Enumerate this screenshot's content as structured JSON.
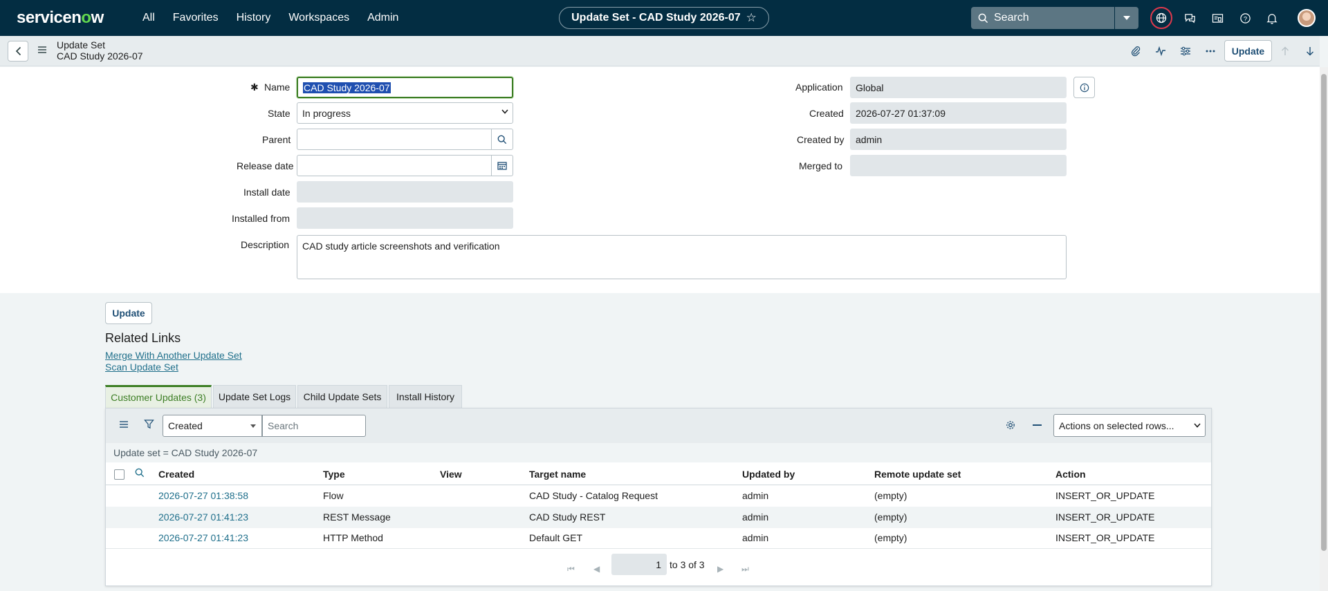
{
  "topnav": {
    "logo": "servicenow",
    "menu": [
      "All",
      "Favorites",
      "History",
      "Workspaces",
      "Admin"
    ],
    "title": "Update Set - CAD Study 2026-07",
    "search_placeholder": "Search",
    "icons": [
      "globe-icon",
      "chat-icon",
      "inbox-icon",
      "help-icon",
      "bell-icon"
    ]
  },
  "header": {
    "line1": "Update Set",
    "line2": "CAD Study 2026-07",
    "update_label": "Update"
  },
  "form": {
    "name_label": "Name",
    "name_value": "CAD Study 2026-07",
    "state_label": "State",
    "state_value": "In progress",
    "parent_label": "Parent",
    "parent_value": "",
    "release_label": "Release date",
    "release_value": "",
    "install_date_label": "Install date",
    "install_date_value": "",
    "installed_from_label": "Installed from",
    "installed_from_value": "",
    "description_label": "Description",
    "description_value": "CAD study article screenshots and verification",
    "application_label": "Application",
    "application_value": "Global",
    "created_label": "Created",
    "created_value": "2026-07-27 01:37:09",
    "created_by_label": "Created by",
    "created_by_value": "admin",
    "merged_to_label": "Merged to",
    "merged_to_value": ""
  },
  "lower": {
    "update_label": "Update",
    "related_title": "Related Links",
    "links": [
      "Merge With Another Update Set",
      "Scan Update Set"
    ],
    "tabs": [
      "Customer Updates (3)",
      "Update Set Logs",
      "Child Update Sets",
      "Install History"
    ]
  },
  "list": {
    "filter_field": "Created",
    "search_placeholder": "Search",
    "actions_label": "Actions on selected rows...",
    "breadcrumb": "Update set = CAD Study 2026-07",
    "columns": [
      "Created",
      "Type",
      "View",
      "Target name",
      "Updated by",
      "Remote update set",
      "Action"
    ],
    "rows": [
      [
        "2026-07-27 01:38:58",
        "Flow",
        "",
        "CAD Study - Catalog Request",
        "admin",
        "(empty)",
        "INSERT_OR_UPDATE"
      ],
      [
        "2026-07-27 01:41:23",
        "REST Message",
        "",
        "CAD Study REST",
        "admin",
        "(empty)",
        "INSERT_OR_UPDATE"
      ],
      [
        "2026-07-27 01:41:23",
        "HTTP Method",
        "",
        "Default GET",
        "admin",
        "(empty)",
        "INSERT_OR_UPDATE"
      ]
    ],
    "page_current": "1",
    "page_range": "to 3 of 3"
  },
  "colors": {
    "nav_bg": "#032d42",
    "accent_green": "#3b7d23",
    "link_blue": "#1f6f8b"
  }
}
